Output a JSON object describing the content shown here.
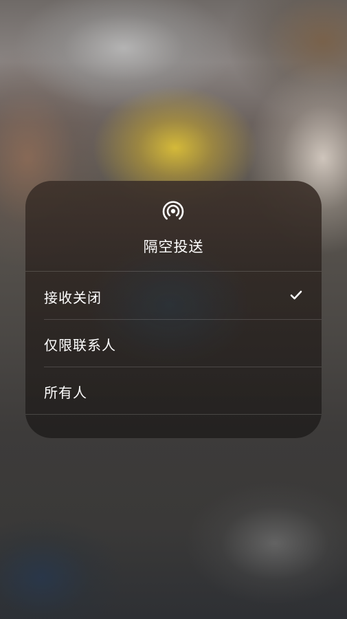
{
  "airdrop_sheet": {
    "icon": "airdrop-icon",
    "title": "隔空投送",
    "options": [
      {
        "label": "接收关闭",
        "selected": true
      },
      {
        "label": "仅限联系人",
        "selected": false
      },
      {
        "label": "所有人",
        "selected": false
      }
    ],
    "check_icon": "checkmark-icon"
  },
  "colors": {
    "text": "#ffffff",
    "separator": "rgba(255,255,255,0.16)"
  }
}
